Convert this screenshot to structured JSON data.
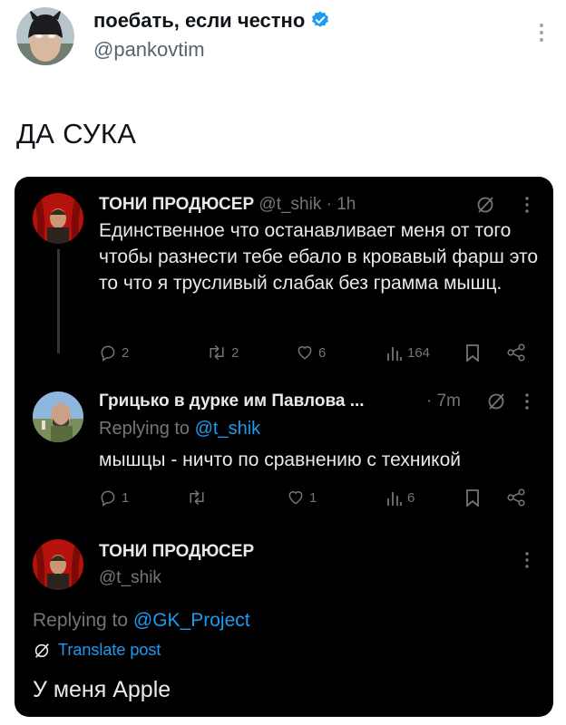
{
  "outer": {
    "display_name": "поебать, если честно",
    "handle": "@pankovtim",
    "text": "ДА СУКА"
  },
  "quoted": {
    "tweet1": {
      "name": "ТОНИ ПРОДЮСЕР",
      "handle": "@t_shik",
      "time": "· 1h",
      "text": "Единственное что останавливает меня от того чтобы разнести тебе ебало в кровавый фарш это то что я трусливый слабак без грамма мышц.",
      "replies": "2",
      "reposts": "2",
      "likes": "6",
      "views": "164"
    },
    "tweet2": {
      "name": "Грицько в дурке им Павлова ...",
      "time": "· 7m",
      "replying_prefix": "Replying to",
      "replying_to": "@t_shik",
      "text": "мышцы - ничто по сравнению с техникой",
      "replies": "1",
      "reposts": "",
      "likes": "1",
      "views": "6"
    },
    "tweet3": {
      "name": "ТОНИ ПРОДЮСЕР",
      "handle": "@t_shik",
      "replying_prefix": "Replying to",
      "replying_to": "@GK_Project",
      "translate": "Translate post",
      "text": "У меня Apple"
    }
  },
  "colors": {
    "accent": "#1d9bf0",
    "card_bg": "#000000",
    "muted": "#71767b"
  }
}
